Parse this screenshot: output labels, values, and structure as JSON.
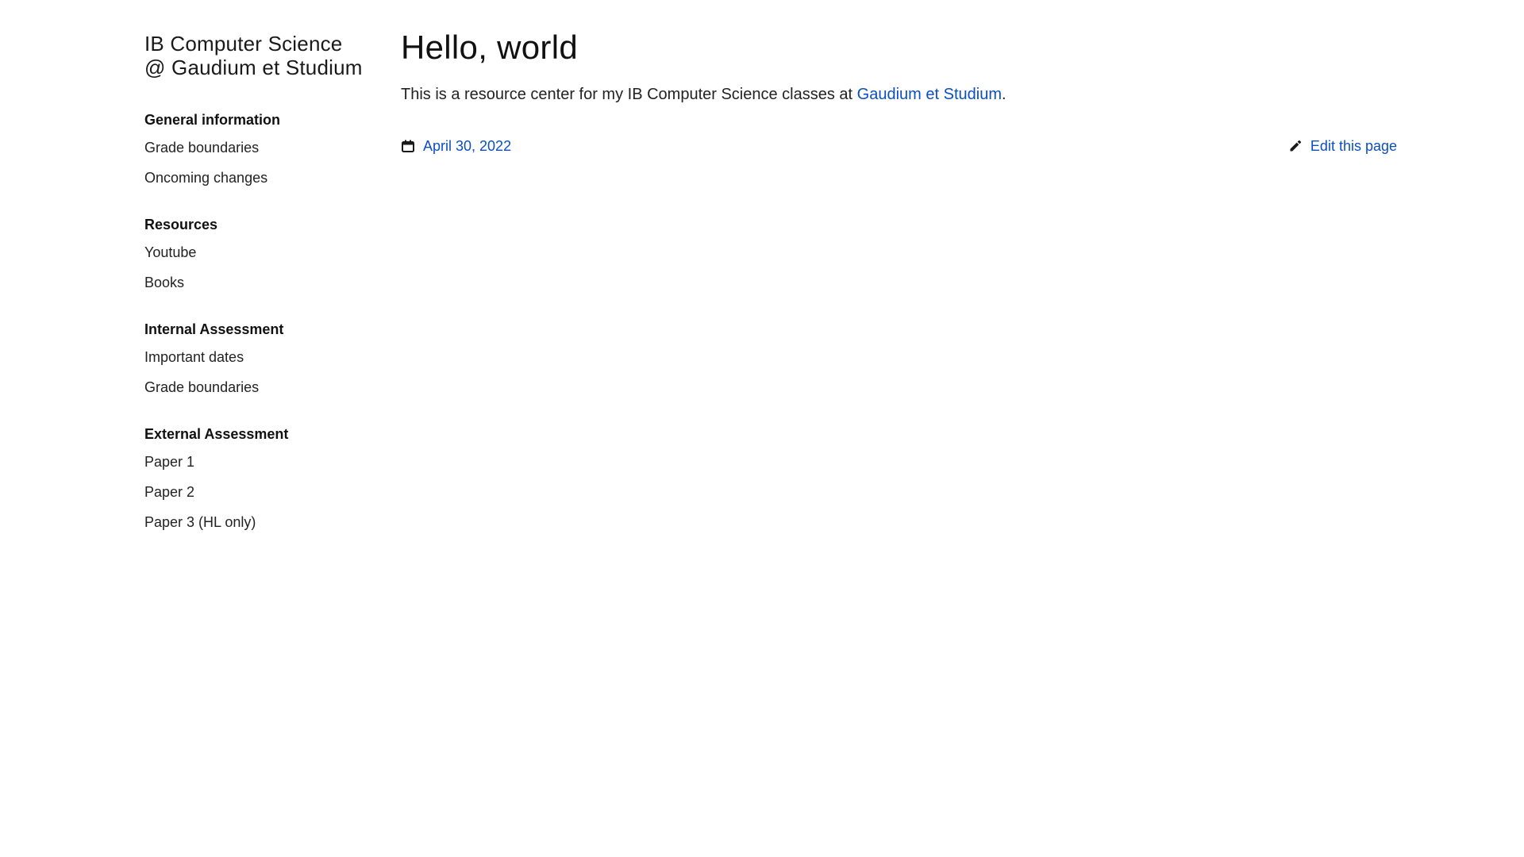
{
  "sidebar": {
    "site_title_line1": "IB Computer Science",
    "site_title_line2": "@ Gaudium et Studium",
    "groups": [
      {
        "heading": "General information",
        "items": [
          "Grade boundaries",
          "Oncoming changes"
        ]
      },
      {
        "heading": "Resources",
        "items": [
          "Youtube",
          "Books"
        ]
      },
      {
        "heading": "Internal Assessment",
        "items": [
          "Important dates",
          "Grade boundaries"
        ]
      },
      {
        "heading": "External Assessment",
        "items": [
          "Paper 1",
          "Paper 2",
          "Paper 3 (HL only)"
        ]
      }
    ]
  },
  "main": {
    "title": "Hello, world",
    "intro_text": "This is a resource center for my IB Computer Science classes at ",
    "intro_link": "Gaudium et Studium",
    "intro_end": ".",
    "date": "April 30, 2022",
    "edit_label": "Edit this page"
  },
  "icons": {
    "date": "calendar-icon",
    "edit": "pencil-icon"
  },
  "colors": {
    "link": "#0b4fc0",
    "text": "#1a1a1a",
    "background": "#ffffff"
  }
}
